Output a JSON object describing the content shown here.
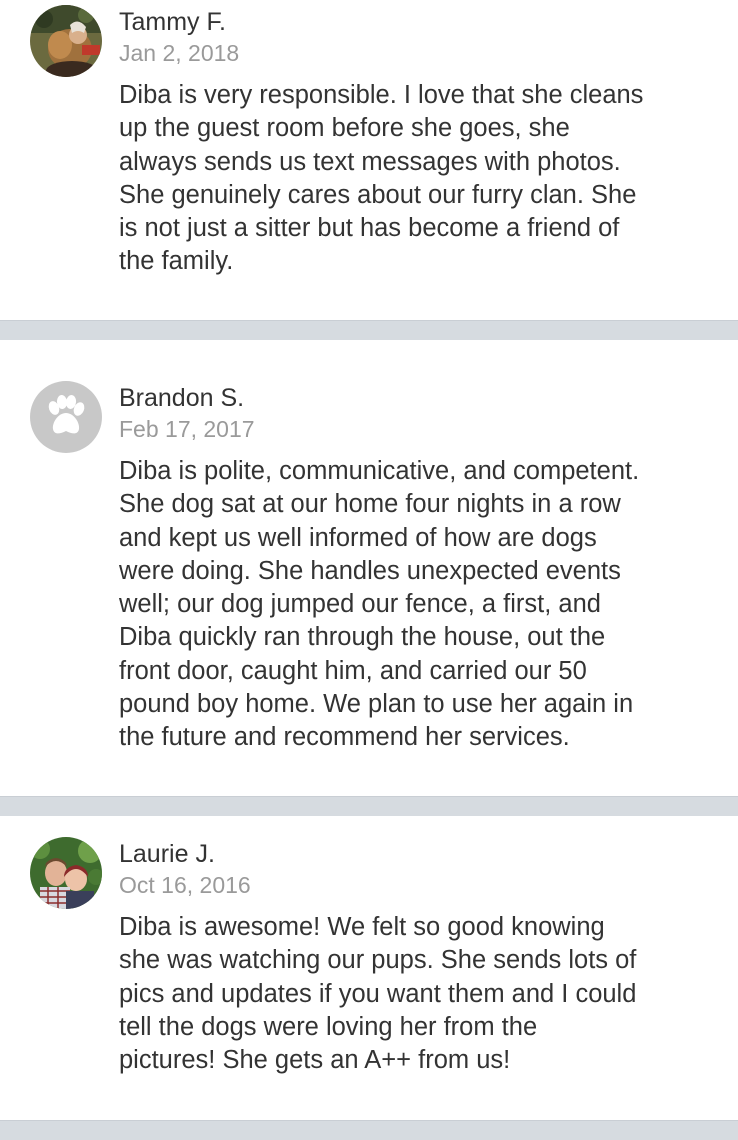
{
  "reviews": [
    {
      "author": "Tammy F.",
      "date": "Jan 2, 2018",
      "avatar_icon": "user-photo",
      "lines": [
        "Diba is very responsible. I love that she cleans",
        "up the guest room before she goes, she",
        "always sends us text messages with photos.",
        "She genuinely cares about our furry clan. She",
        "is not just a sitter but has become a friend of",
        "the family."
      ]
    },
    {
      "author": "Brandon S.",
      "date": "Feb 17, 2017",
      "avatar_icon": "paw-print-icon",
      "lines": [
        "Diba is polite, communicative, and competent.",
        "She dog sat at our home four nights in a row",
        "and kept us well informed of how are dogs",
        "were doing. She handles unexpected events",
        "well; our dog jumped our fence, a first, and",
        "Diba quickly ran through the house, out the",
        "front door, caught him, and carried our 50",
        "pound boy home. We plan to use her again in",
        "the future and recommend her services."
      ]
    },
    {
      "author": "Laurie J.",
      "date": "Oct 16, 2016",
      "avatar_icon": "user-photo",
      "lines": [
        "Diba is awesome! We felt so good knowing",
        "she was watching our pups. She sends lots of",
        "pics and updates if you want them and I could",
        "tell the dogs were loving her from the",
        "pictures! She gets an A++ from us!"
      ]
    }
  ],
  "colors": {
    "text": "#333333",
    "date": "#9a9a9a",
    "separator": "#d6dbe0",
    "avatar_placeholder": "#c8c8c8"
  }
}
